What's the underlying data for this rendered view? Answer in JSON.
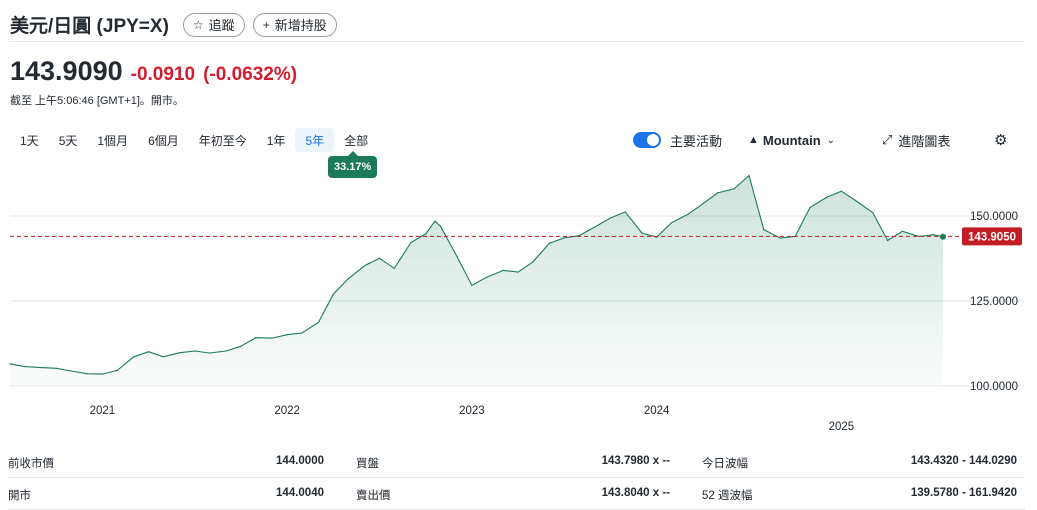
{
  "header": {
    "title": "美元/日圓 (JPY=X)",
    "follow_label": "追蹤",
    "add_label": "新增持股"
  },
  "quote": {
    "price": "143.9090",
    "change": "-0.0910",
    "change_pct": "(-0.0632%)",
    "as_of": "截至 上午5:06:46 [GMT+1]。開市。"
  },
  "ranges": {
    "items": [
      "1天",
      "5天",
      "1個月",
      "6個月",
      "年初至今",
      "1年",
      "5年",
      "全部"
    ],
    "active": "5年",
    "badge": "33.17%"
  },
  "tools": {
    "key_events": "主要活動",
    "chart_type": "Mountain",
    "advanced": "進階圖表"
  },
  "colors": {
    "line": "#1a7a5a",
    "fill": "#1a7a5a",
    "negative": "#d31d2f",
    "last_price_tag": "#c41c24",
    "accent": "#1a73e8"
  },
  "chart_data": {
    "type": "area",
    "title": "",
    "xlabel": "",
    "ylabel": "",
    "x_ticks": [
      "2021",
      "2022",
      "2023",
      "2024",
      "2025"
    ],
    "y_ticks": [
      "150.0000",
      "125.0000",
      "100.0000"
    ],
    "ylim": [
      95,
      165
    ],
    "last_price_label": "143.9050",
    "previous_close": 144.0,
    "series": [
      {
        "x": [
          2020.5,
          2020.58,
          2020.67,
          2020.75,
          2020.83,
          2020.92,
          2021.0,
          2021.08,
          2021.17,
          2021.25,
          2021.33,
          2021.42,
          2021.5,
          2021.58,
          2021.67,
          2021.75,
          2021.83,
          2021.92,
          2022.0,
          2022.08,
          2022.17,
          2022.25,
          2022.33,
          2022.42,
          2022.5,
          2022.58,
          2022.67,
          2022.75,
          2022.8,
          2022.83,
          2022.92,
          2023.0,
          2023.08,
          2023.17,
          2023.25,
          2023.33,
          2023.42,
          2023.5,
          2023.58,
          2023.67,
          2023.75,
          2023.83,
          2023.92,
          2024.0,
          2024.08,
          2024.17,
          2024.25,
          2024.33,
          2024.42,
          2024.5,
          2024.58,
          2024.67,
          2024.75,
          2024.83,
          2024.92,
          2025.0,
          2025.08,
          2025.17,
          2025.25,
          2025.33,
          2025.42,
          2025.5,
          2025.55
        ],
        "values": [
          106.5,
          105.7,
          105.4,
          105.2,
          104.4,
          103.6,
          103.5,
          104.6,
          108.6,
          110.1,
          108.6,
          109.8,
          110.3,
          109.7,
          110.3,
          111.7,
          114.2,
          114.1,
          115.1,
          115.6,
          118.7,
          127.0,
          131.5,
          135.4,
          137.6,
          134.6,
          142.2,
          144.7,
          148.5,
          147.0,
          138.0,
          129.6,
          132.0,
          134.0,
          133.5,
          136.5,
          142.0,
          143.6,
          144.2,
          146.9,
          149.4,
          151.2,
          145.0,
          143.8,
          148.0,
          150.5,
          153.6,
          156.8,
          158.0,
          161.9,
          146.0,
          143.5,
          144.0,
          152.5,
          155.5,
          157.3,
          154.4,
          151.0,
          142.8,
          145.5,
          144.0,
          144.5,
          143.9
        ]
      }
    ],
    "grid": true,
    "y_axis_side": "right"
  },
  "stats": [
    {
      "label": "前收市價",
      "value": "144.0000"
    },
    {
      "label": "買盤",
      "value": "143.7980 x --"
    },
    {
      "label": "今日波幅",
      "value": "143.4320 - 144.0290"
    },
    {
      "label": "開市",
      "value": "144.0040"
    },
    {
      "label": "賣出價",
      "value": "143.8040 x --"
    },
    {
      "label": "52 週波幅",
      "value": "139.5780 - 161.9420"
    }
  ]
}
